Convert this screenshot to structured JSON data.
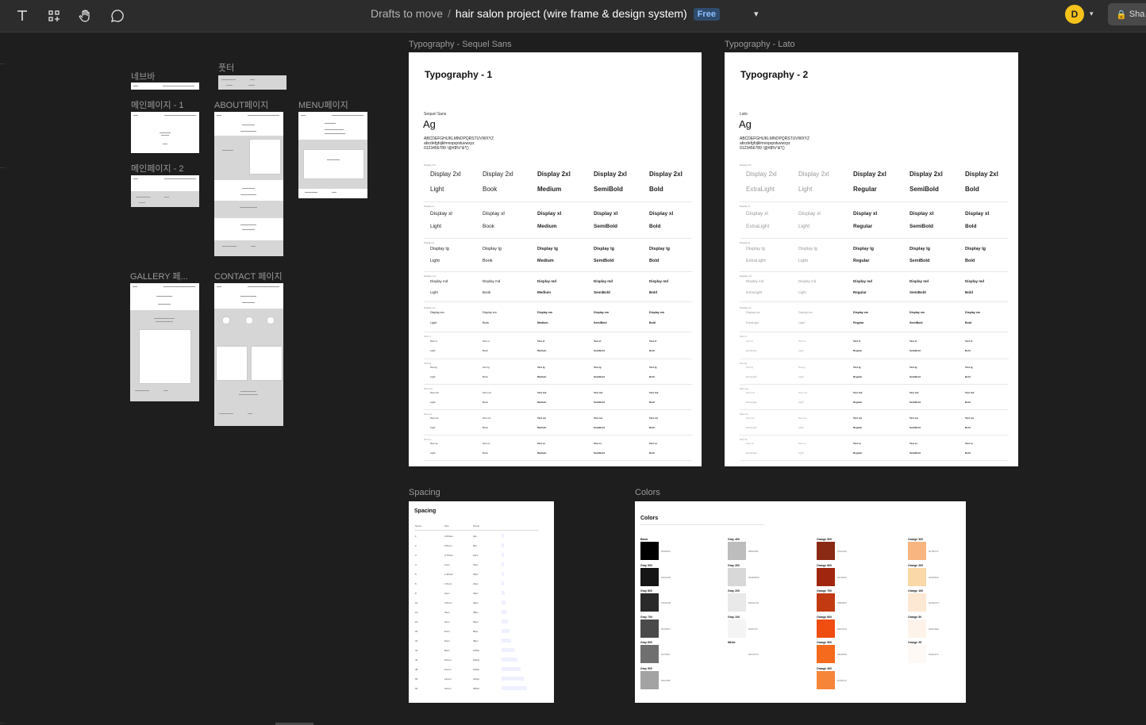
{
  "toolbar": {
    "tools": [
      "text-tool",
      "components-tool",
      "hand-tool",
      "comment-tool"
    ],
    "breadcrumb_parent": "Drafts to move",
    "breadcrumb_sep": "/",
    "file_name": "hair salon project (wire frame & design system)",
    "plan_badge": "Free",
    "avatar_initial": "D",
    "share_label": "Sha"
  },
  "frames": {
    "navbar": "네브바",
    "footer": "풋터",
    "main1": "메인페이지 - 1",
    "about": "ABOUT페이지",
    "menu": "MENU페이지",
    "main2": "메인페이지 - 2",
    "gallery": "GALLERY 페...",
    "contact": "CONTACT 페이지",
    "typo_sequel": "Typography - Sequel Sans",
    "typo_lato": "Typography - Lato",
    "spacing": "Spacing",
    "colors": "Colors"
  },
  "typography_sequel": {
    "title": "Typography - 1",
    "family": "Sequel Sans",
    "sample": "Ag",
    "chars": [
      "ABCDEFGHIJKLMNOPQRSTUVWXYZ",
      "abcdefghijklmnopqrstuvwxyz",
      "0123456789 !@#$%^&*()"
    ],
    "rows": [
      {
        "name": "Display 2xl",
        "weights": [
          "Light",
          "Book",
          "Medium",
          "SemiBold",
          "Bold"
        ]
      },
      {
        "name": "Display xl",
        "weights": [
          "Light",
          "Book",
          "Medium",
          "SemiBold",
          "Bold"
        ]
      },
      {
        "name": "Display lg",
        "weights": [
          "Light",
          "Book",
          "Medium",
          "SemiBold",
          "Bold"
        ]
      },
      {
        "name": "Display md",
        "weights": [
          "Light",
          "Book",
          "Medium",
          "SemiBold",
          "Bold"
        ]
      },
      {
        "name": "Display sm",
        "weights": [
          "Light",
          "Book",
          "Medium",
          "SemiBold",
          "Bold"
        ]
      },
      {
        "name": "Text xl",
        "weights": [
          "Light",
          "Book",
          "Medium",
          "SemiBold",
          "Bold"
        ]
      },
      {
        "name": "Text lg",
        "weights": [
          "Light",
          "Book",
          "Medium",
          "SemiBold",
          "Bold"
        ]
      },
      {
        "name": "Text md",
        "weights": [
          "Light",
          "Book",
          "Medium",
          "SemiBold",
          "Bold"
        ]
      },
      {
        "name": "Text sm",
        "weights": [
          "Light",
          "Book",
          "Medium",
          "SemiBold",
          "Bold"
        ]
      },
      {
        "name": "Text xs",
        "weights": [
          "Light",
          "Book",
          "Medium",
          "SemiBold",
          "Bold"
        ]
      }
    ]
  },
  "typography_lato": {
    "title": "Typography - 2",
    "family": "Lato",
    "sample": "Ag",
    "chars": [
      "ABCDEFGHIJKLMNOPQRSTUVWXYZ",
      "abcdefghijklmnopqrstuvwxyz",
      "0123456789 !@#$%^&*()"
    ],
    "rows": [
      {
        "name": "Display 2xl",
        "weights": [
          "ExtraLight",
          "Light",
          "Regular",
          "SemiBold",
          "Bold"
        ]
      },
      {
        "name": "Display xl",
        "weights": [
          "ExtraLight",
          "Light",
          "Regular",
          "SemiBold",
          "Bold"
        ]
      },
      {
        "name": "Display lg",
        "weights": [
          "ExtraLight",
          "Light",
          "Regular",
          "SemiBold",
          "Bold"
        ]
      },
      {
        "name": "Display md",
        "weights": [
          "ExtraLight",
          "Light",
          "Regular",
          "SemiBold",
          "Bold"
        ]
      },
      {
        "name": "Display sm",
        "weights": [
          "ExtraLight",
          "Light",
          "Regular",
          "SemiBold",
          "Bold"
        ]
      },
      {
        "name": "Text xl",
        "weights": [
          "ExtraLight",
          "Light",
          "Regular",
          "SemiBold",
          "Bold"
        ]
      },
      {
        "name": "Text lg",
        "weights": [
          "ExtraLight",
          "Light",
          "Regular",
          "SemiBold",
          "Bold"
        ]
      },
      {
        "name": "Text md",
        "weights": [
          "ExtraLight",
          "Light",
          "Regular",
          "SemiBold",
          "Bold"
        ]
      },
      {
        "name": "Text sm",
        "weights": [
          "ExtraLight",
          "Light",
          "Regular",
          "SemiBold",
          "Bold"
        ]
      },
      {
        "name": "Text xs",
        "weights": [
          "ExtraLight",
          "Light",
          "Regular",
          "SemiBold",
          "Bold"
        ]
      }
    ]
  },
  "spacing": {
    "title": "Spacing",
    "headers": [
      "Name",
      "Size",
      "Pixels"
    ],
    "rows": [
      [
        "1",
        "0.25rem",
        "4px"
      ],
      [
        "2",
        "0.5rem",
        "8px"
      ],
      [
        "3",
        "0.75rem",
        "12px"
      ],
      [
        "4",
        "1rem",
        "16px"
      ],
      [
        "5",
        "1.25rem",
        "20px"
      ],
      [
        "6",
        "1.5rem",
        "24px"
      ],
      [
        "8",
        "2rem",
        "32px"
      ],
      [
        "10",
        "2.5rem",
        "40px"
      ],
      [
        "12",
        "3rem",
        "48px"
      ],
      [
        "16",
        "4rem",
        "64px"
      ],
      [
        "20",
        "5rem",
        "80px"
      ],
      [
        "24",
        "6rem",
        "96px"
      ],
      [
        "32",
        "8rem",
        "128px"
      ],
      [
        "40",
        "10rem",
        "160px"
      ],
      [
        "48",
        "12rem",
        "192px"
      ],
      [
        "56",
        "14rem",
        "224px"
      ],
      [
        "64",
        "16rem",
        "256px"
      ]
    ]
  },
  "colors": {
    "title": "Colors",
    "columns": [
      [
        {
          "name": "Black",
          "hex": "#000000"
        },
        {
          "name": "Gray 900",
          "hex": "#101828"
        },
        {
          "name": "Gray 800",
          "hex": "#1D2939"
        },
        {
          "name": "Gray 700",
          "hex": "#344054"
        },
        {
          "name": "Gray 600",
          "hex": "#475467"
        },
        {
          "name": "Gray 500",
          "hex": "#667085"
        }
      ],
      [
        {
          "name": "Gray 400",
          "hex": "#98A2B3"
        },
        {
          "name": "Gray 300",
          "hex": "#D0D5DD"
        },
        {
          "name": "Gray 200",
          "hex": "#EAECF0"
        },
        {
          "name": "Gray 100",
          "hex": "#F2F4F7"
        },
        {
          "name": "White",
          "hex": "#FFFFFF"
        }
      ],
      [
        {
          "name": "Orange 900",
          "hex": "#7E2410"
        },
        {
          "name": "Orange 800",
          "hex": "#97180C"
        },
        {
          "name": "Orange 700",
          "hex": "#B93815"
        },
        {
          "name": "Orange 600",
          "hex": "#E04F16"
        },
        {
          "name": "Orange 500",
          "hex": "#EF6820"
        },
        {
          "name": "Orange 400",
          "hex": "#F38744"
        }
      ],
      [
        {
          "name": "Orange 300",
          "hex": "#F7B27A"
        },
        {
          "name": "Orange 200",
          "hex": "#F9DBAF"
        },
        {
          "name": "Orange 100",
          "hex": "#FDEAD7"
        },
        {
          "name": "Orange 50",
          "hex": "#FEF6EE"
        },
        {
          "name": "Orange 25",
          "hex": "#FEFAF5"
        }
      ]
    ],
    "display_fills": [
      [
        "#000000",
        "#151515",
        "#2a2a2a",
        "#4a4a4a",
        "#6f6f6f",
        "#a3a3a3"
      ],
      [
        "#bdbdbd",
        "#d8d8d8",
        "#e9e9e9",
        "#f4f4f4",
        "#ffffff"
      ],
      [
        "#8a2a14",
        "#a1260f",
        "#c23a12",
        "#f04d10",
        "#f56a1c",
        "#f6853a"
      ],
      [
        "#f9b57f",
        "#fbd8a7",
        "#fde8d3",
        "#fdf3ea",
        "#fef9f4"
      ]
    ]
  }
}
